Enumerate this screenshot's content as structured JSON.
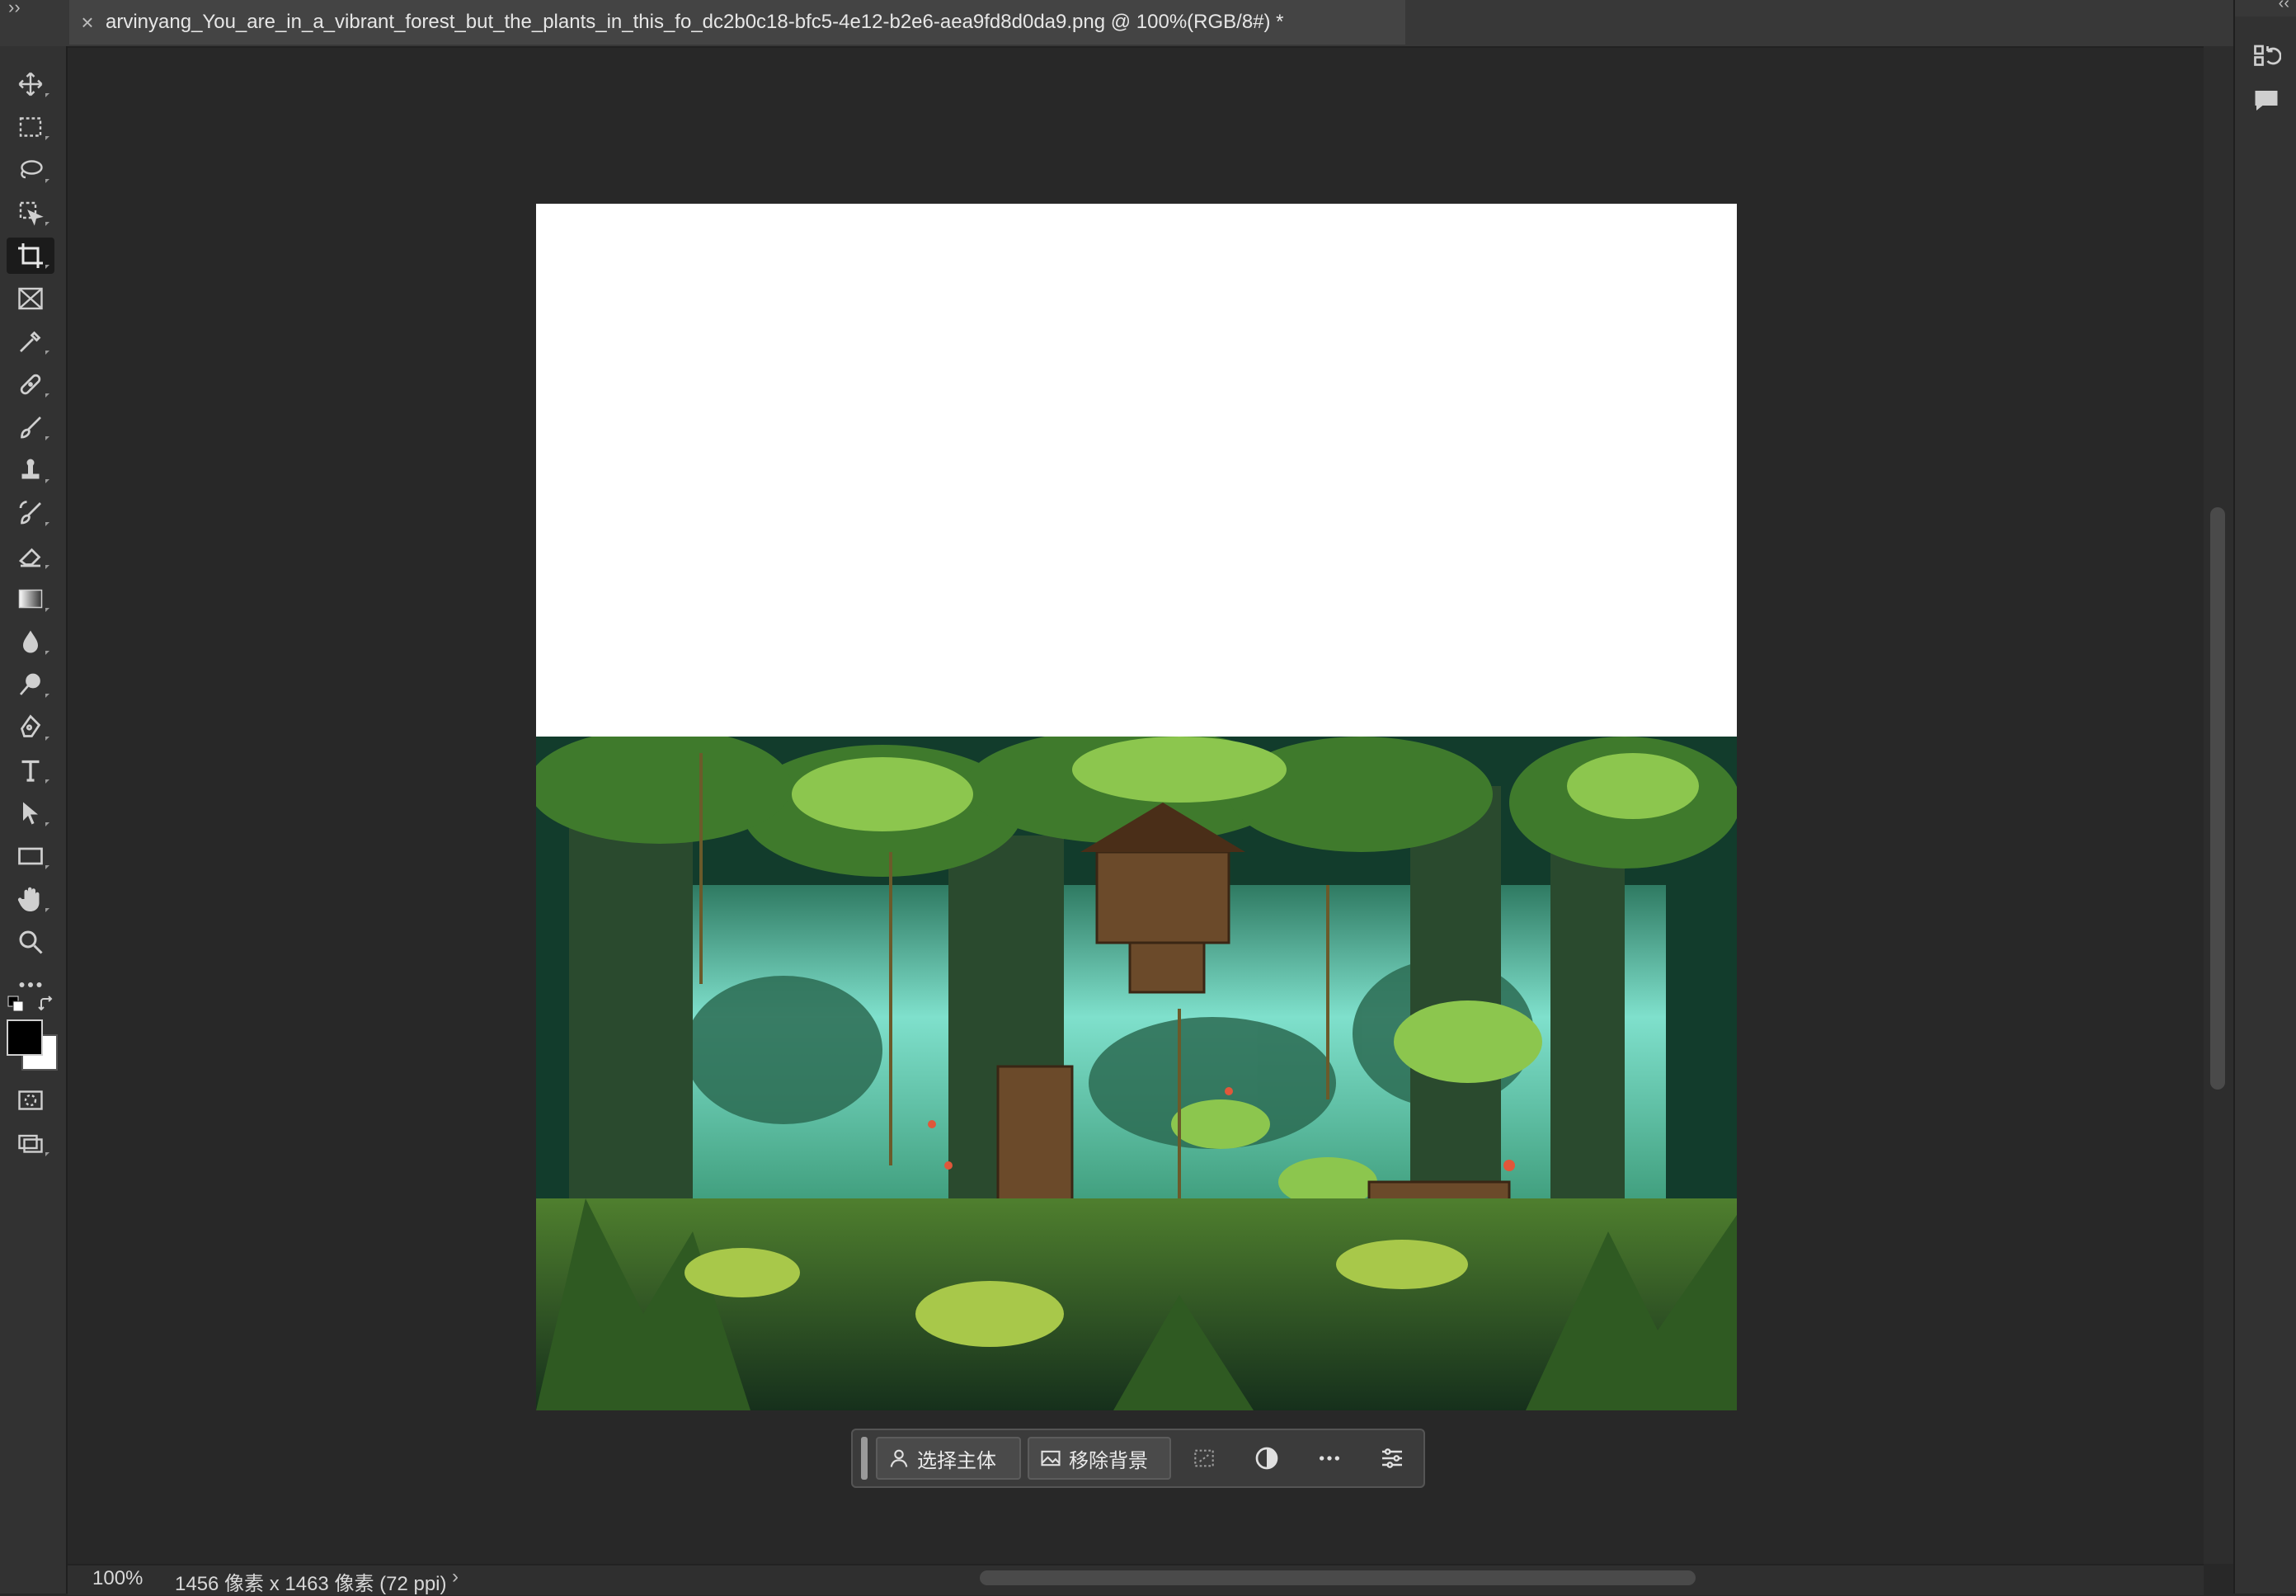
{
  "document": {
    "tab_title": "arvinyang_You_are_in_a_vibrant_forest_but_the_plants_in_this_fo_dc2b0c18-bfc5-4e12-b2e6-aea9fd8d0da9.png @ 100%(RGB/8#) *",
    "close_glyph": "×"
  },
  "toolbar": {
    "collapse_glyph": "››",
    "tools": [
      {
        "name": "move-tool",
        "icon": "move-icon"
      },
      {
        "name": "rectangular-marquee-tool",
        "icon": "marquee-icon"
      },
      {
        "name": "lasso-tool",
        "icon": "lasso-icon"
      },
      {
        "name": "object-selection-tool",
        "icon": "object-selection-icon"
      },
      {
        "name": "crop-tool",
        "icon": "crop-icon",
        "active": true
      },
      {
        "name": "frame-tool",
        "icon": "frame-icon"
      },
      {
        "name": "eyedropper-tool",
        "icon": "eyedropper-icon"
      },
      {
        "name": "spot-healing-tool",
        "icon": "bandage-icon"
      },
      {
        "name": "brush-tool",
        "icon": "brush-icon"
      },
      {
        "name": "clone-stamp-tool",
        "icon": "stamp-icon"
      },
      {
        "name": "history-brush-tool",
        "icon": "history-brush-icon"
      },
      {
        "name": "eraser-tool",
        "icon": "eraser-icon"
      },
      {
        "name": "gradient-tool",
        "icon": "gradient-icon"
      },
      {
        "name": "blur-tool",
        "icon": "drop-icon"
      },
      {
        "name": "dodge-tool",
        "icon": "dodge-icon"
      },
      {
        "name": "pen-tool",
        "icon": "pen-icon"
      },
      {
        "name": "type-tool",
        "icon": "type-icon"
      },
      {
        "name": "path-selection-tool",
        "icon": "arrow-icon"
      },
      {
        "name": "rectangle-tool",
        "icon": "rectangle-icon"
      },
      {
        "name": "hand-tool",
        "icon": "hand-icon"
      },
      {
        "name": "zoom-tool",
        "icon": "magnifier-icon"
      },
      {
        "name": "more-tools",
        "icon": "ellipsis-icon"
      }
    ],
    "foreground_color": "#000000",
    "background_color": "#ffffff"
  },
  "right_panel": {
    "collapse_glyph": "‹‹",
    "buttons": [
      {
        "name": "history-panel-button",
        "icon": "history-icon"
      },
      {
        "name": "comments-panel-button",
        "icon": "comment-icon"
      }
    ]
  },
  "contextual_taskbar": {
    "select_subject_label": "选择主体",
    "remove_background_label": "移除背景",
    "icons": [
      "transform-selection-icon",
      "adjustment-icon",
      "more-icon",
      "settings-sliders-icon"
    ]
  },
  "status": {
    "zoom": "100%",
    "doc_info": "1456 像素 x 1463 像素 (72 ppi)",
    "arrow": "›"
  },
  "canvas": {
    "background": "#ffffff",
    "image_description_colors": [
      "#0f3a2c",
      "#2f6b3a",
      "#7fbf5a",
      "#7fe0cc",
      "#6b4a2a"
    ]
  }
}
